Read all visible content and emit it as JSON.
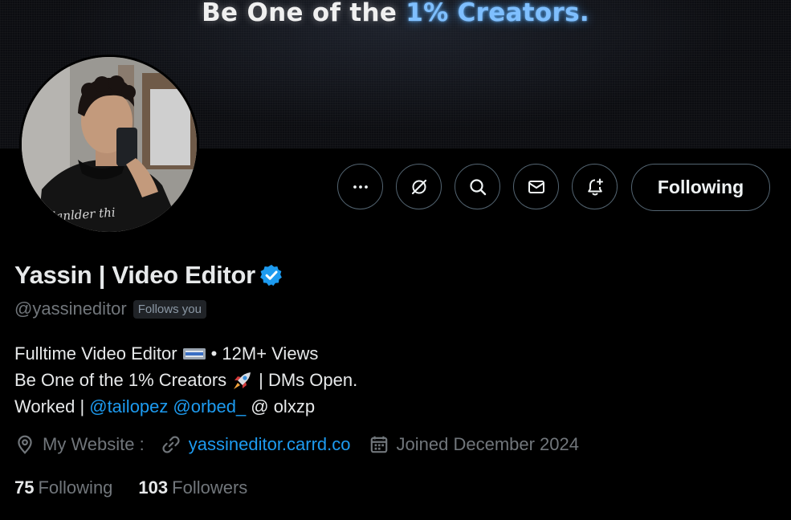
{
  "banner": {
    "text_white": "Be One of the",
    "text_accent": "1% Creators."
  },
  "actions": {
    "more_icon": "more-dots-icon",
    "grok_icon": "grok-icon",
    "search_icon": "search-icon",
    "message_icon": "envelope-icon",
    "notify_icon": "bell-plus-icon",
    "following_label": "Following"
  },
  "profile": {
    "display_name": "Yassin | Video Editor",
    "verified": true,
    "handle": "@yassineditor",
    "follows_you": "Follows you"
  },
  "bio": {
    "line1_text": "Fulltime Video Editor",
    "line1_emoji": "ticket-emoji",
    "line1_suffix": "• 12M+ Views",
    "line2_text": "Be One of the 1% Creators",
    "line2_emoji": "rocket-emoji",
    "line2_suffix": "| DMs Open.",
    "line3_prefix": "Worked |",
    "mention1": "@tailopez",
    "mention2": "@orbed_",
    "line3_suffix": "@ olxzp"
  },
  "meta": {
    "location_icon": "location-pin-icon",
    "location": "My Website :",
    "link_icon": "link-icon",
    "website": "yassineditor.carrd.co",
    "calendar_icon": "calendar-icon",
    "joined": "Joined December 2024"
  },
  "stats": {
    "following_count": "75",
    "following_label": "Following",
    "followers_count": "103",
    "followers_label": "Followers"
  },
  "colors": {
    "background": "#000000",
    "accent_blue": "#1d9bf0",
    "muted_text": "#71767b",
    "border": "#536471",
    "banner_accent": "#7fbfff"
  }
}
